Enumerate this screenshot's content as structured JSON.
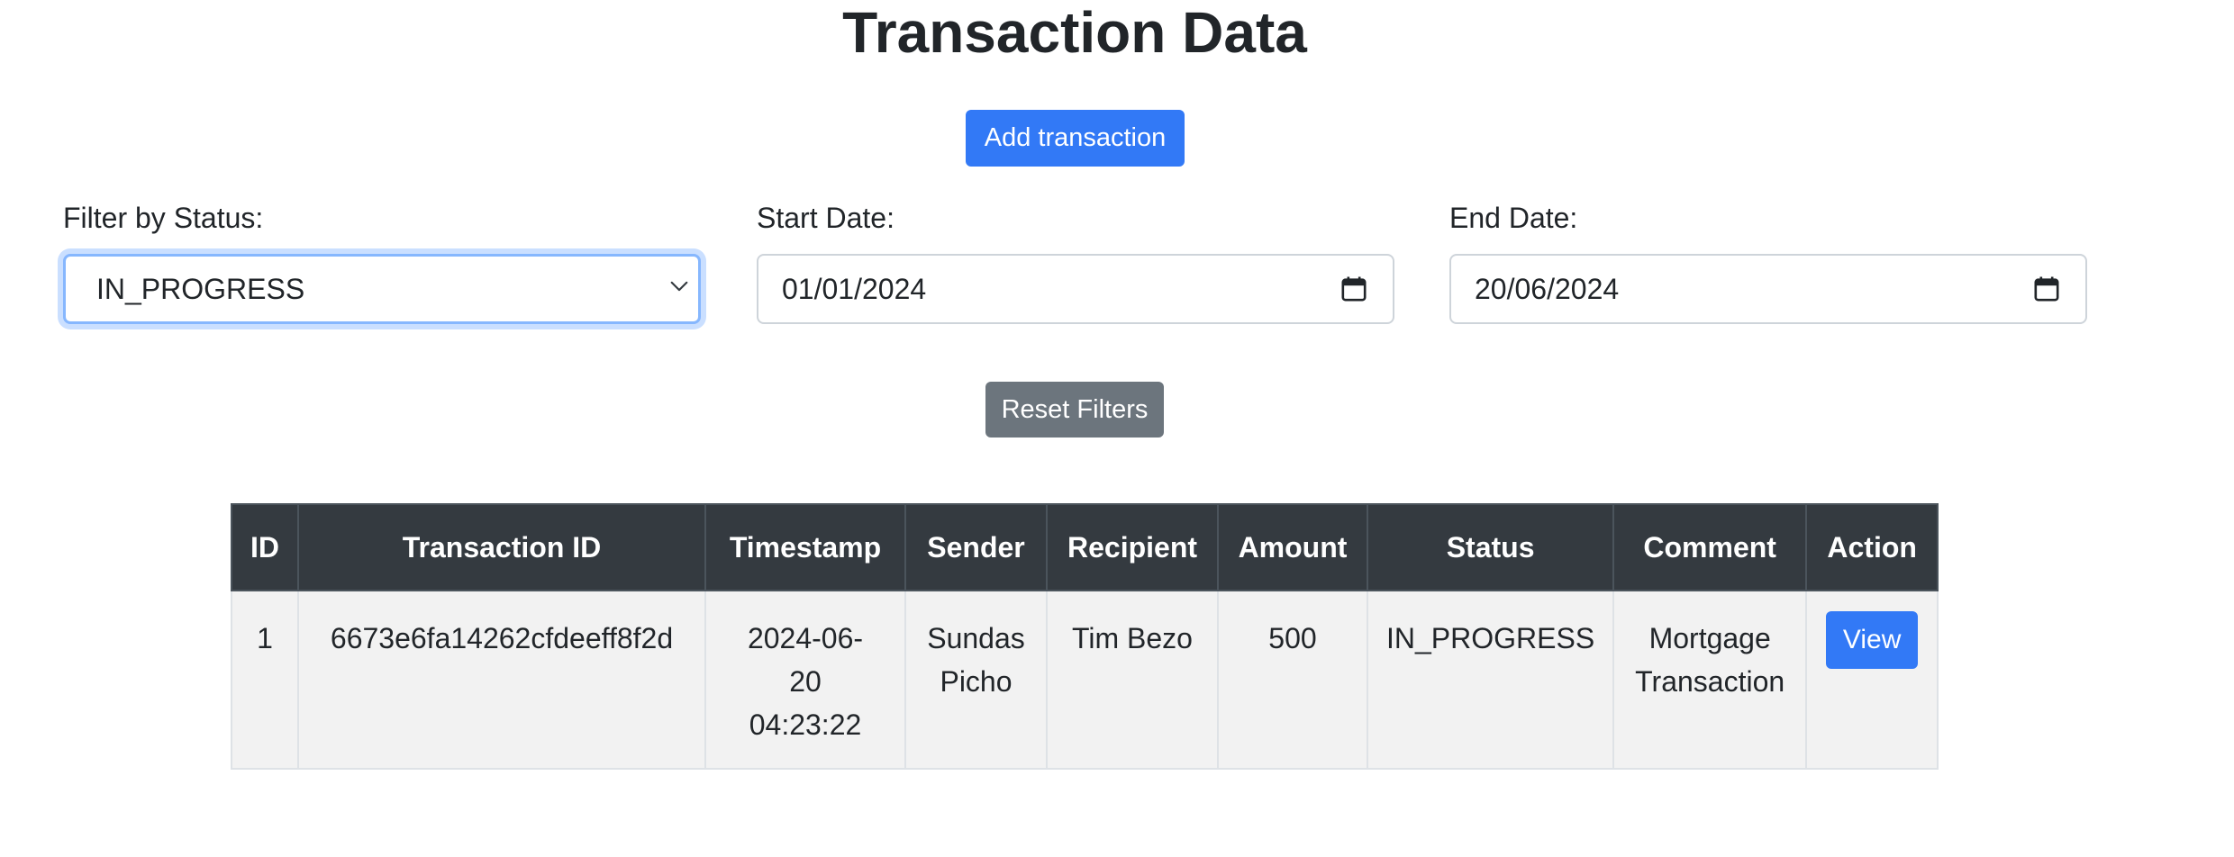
{
  "page": {
    "title": "Transaction Data"
  },
  "actions": {
    "add_label": "Add transaction",
    "reset_label": "Reset Filters"
  },
  "filters": {
    "status": {
      "label": "Filter by Status:",
      "selected": "IN_PROGRESS"
    },
    "start_date": {
      "label": "Start Date:",
      "value": "01/01/2024"
    },
    "end_date": {
      "label": "End Date:",
      "value": "20/06/2024"
    }
  },
  "table": {
    "headers": {
      "id": "ID",
      "transaction_id": "Transaction ID",
      "timestamp": "Timestamp",
      "sender": "Sender",
      "recipient": "Recipient",
      "amount": "Amount",
      "status": "Status",
      "comment": "Comment",
      "action": "Action"
    },
    "rows": [
      {
        "id": "1",
        "transaction_id": "6673e6fa14262cfdeeff8f2d",
        "timestamp": "2024-06-20 04:23:22",
        "sender": "Sundas Picho",
        "recipient": "Tim Bezo",
        "amount": "500",
        "status": "IN_PROGRESS",
        "comment": "Mortgage Transaction",
        "action_label": "View"
      }
    ]
  },
  "colors": {
    "primary": "#3279f6",
    "secondary": "#6c757d",
    "table_header": "#343a40",
    "row_background": "#f2f2f2",
    "focus_ring": "#86b7fe"
  },
  "icons": {
    "status_select": "chevron-down-icon",
    "date_picker": "calendar-icon"
  }
}
